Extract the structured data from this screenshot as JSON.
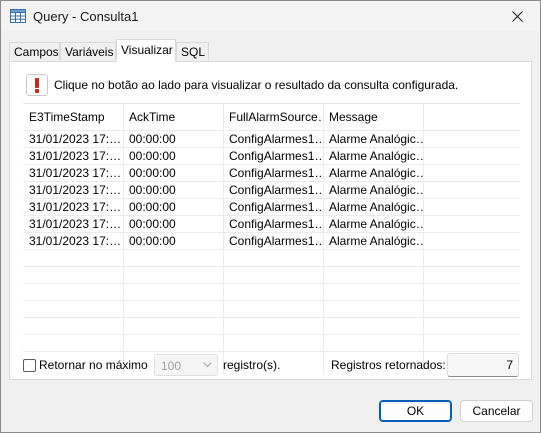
{
  "window": {
    "title": "Query - Consulta1",
    "icon": "table-app-icon"
  },
  "tabs": [
    {
      "label": "Campos",
      "active": false
    },
    {
      "label": "Variáveis",
      "active": false
    },
    {
      "label": "Visualizar",
      "active": true
    },
    {
      "label": "SQL",
      "active": false
    }
  ],
  "info": {
    "icon": "exclamation-icon",
    "text": "Clique no botão ao lado para visualizar o resultado da consulta configurada."
  },
  "grid": {
    "columns": [
      "E3TimeStamp",
      "AckTime",
      "FullAlarmSource…",
      "Message"
    ],
    "rows": [
      [
        "31/01/2023 17:…",
        "00:00:00",
        "ConfigAlarmes1…",
        "Alarme Analógic…"
      ],
      [
        "31/01/2023 17:…",
        "00:00:00",
        "ConfigAlarmes1…",
        "Alarme Analógic…"
      ],
      [
        "31/01/2023 17:…",
        "00:00:00",
        "ConfigAlarmes1…",
        "Alarme Analógic…"
      ],
      [
        "31/01/2023 17:…",
        "00:00:00",
        "ConfigAlarmes1…",
        "Alarme Analógic…"
      ],
      [
        "31/01/2023 17:…",
        "00:00:00",
        "ConfigAlarmes1…",
        "Alarme Analógic…"
      ],
      [
        "31/01/2023 17:…",
        "00:00:00",
        "ConfigAlarmes1…",
        "Alarme Analógic…"
      ],
      [
        "31/01/2023 17:…",
        "00:00:00",
        "ConfigAlarmes1…",
        "Alarme Analógic…"
      ]
    ]
  },
  "footer": {
    "limit_label": "Retornar no máximo",
    "limit_checked": false,
    "limit_value": "100",
    "limit_unit": "registro(s).",
    "returned_label": "Registros retornados:",
    "returned_count": "7"
  },
  "buttons": {
    "ok": "OK",
    "cancel": "Cancelar"
  },
  "colors": {
    "accent": "#005fb8",
    "alert": "#c42b1c"
  }
}
